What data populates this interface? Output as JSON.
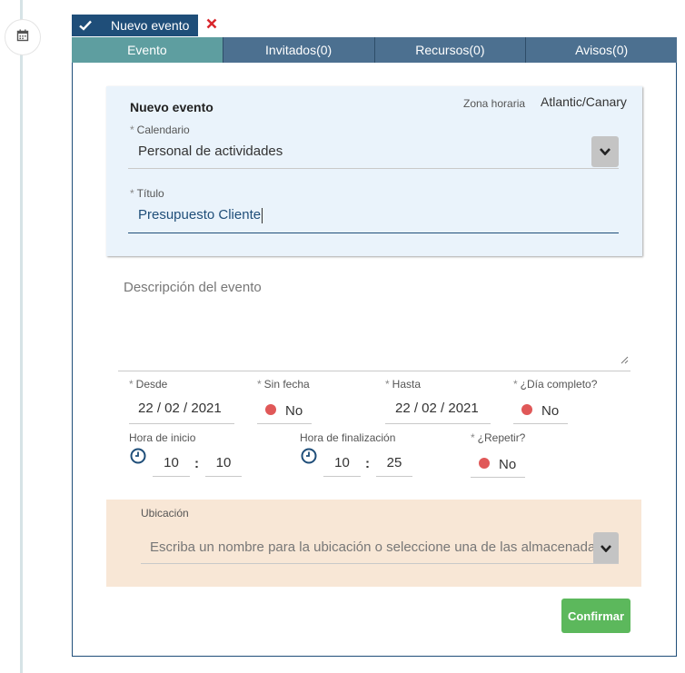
{
  "badge": {
    "title": "Nuevo evento"
  },
  "tabs": [
    {
      "label": "Evento"
    },
    {
      "label": "Invitados(0)"
    },
    {
      "label": "Recursos(0)"
    },
    {
      "label": "Avisos(0)"
    }
  ],
  "header": {
    "title": "Nuevo evento",
    "timezone_label": "Zona horaria",
    "timezone_value": "Atlantic/Canary"
  },
  "calendar": {
    "required_mark": "*",
    "label": "Calendario",
    "value": "Personal de actividades"
  },
  "event_title": {
    "required_mark": "*",
    "label": "Título",
    "value": "Presupuesto Cliente"
  },
  "description": {
    "placeholder": "Descripción del evento"
  },
  "dates": {
    "from": {
      "required_mark": "*",
      "label": "Desde",
      "value": "22 / 02 / 2021"
    },
    "no_date": {
      "required_mark": "*",
      "label": "Sin fecha",
      "value": "No"
    },
    "to": {
      "required_mark": "*",
      "label": "Hasta",
      "value": "22 / 02 / 2021"
    },
    "all_day": {
      "required_mark": "*",
      "label": "¿Día completo?",
      "value": "No"
    }
  },
  "times": {
    "start": {
      "label": "Hora de inicio",
      "hour": "10",
      "minute": "10"
    },
    "end": {
      "label": "Hora de finalización",
      "hour": "10",
      "minute": "25"
    },
    "separator": ":",
    "repeat": {
      "required_mark": "*",
      "label": "¿Repetir?",
      "value": "No"
    }
  },
  "location": {
    "label": "Ubicación",
    "placeholder": "Escriba un nombre para la ubicación o seleccione una de las almacenadas"
  },
  "confirm_label": "Confirmar",
  "colors": {
    "primary": "#1f4e79",
    "tab_bg": "#4c7090",
    "tab_active": "#5e9ea0",
    "header_bg": "#eaf3fb",
    "location_bg": "#f8e7d6",
    "confirm": "#5cb85c",
    "toggle_off": "#e05858",
    "close": "#d9262c"
  }
}
